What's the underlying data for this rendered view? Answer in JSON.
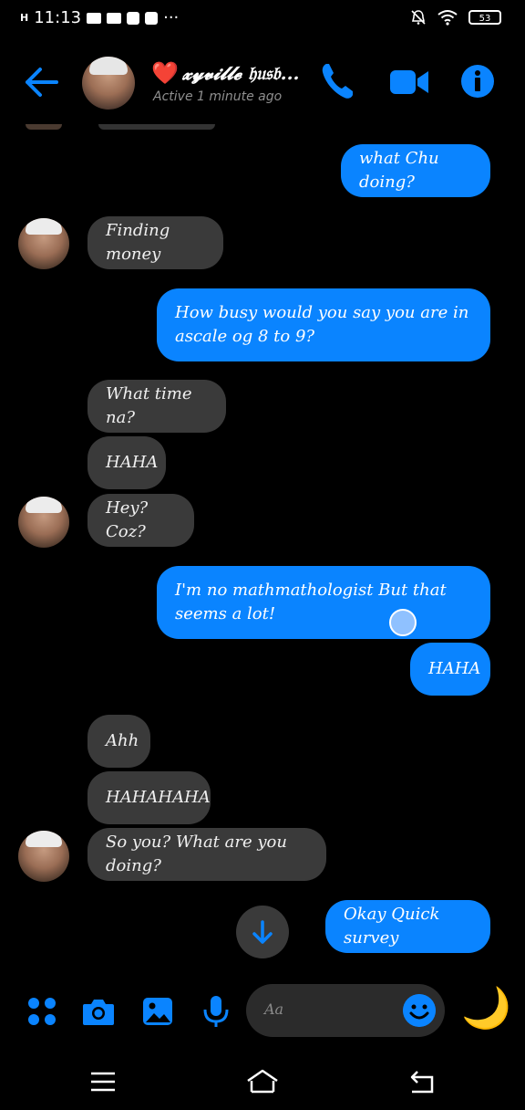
{
  "status_bar": {
    "carrier": "H",
    "time": "11:13",
    "more": "···",
    "battery": "53"
  },
  "header": {
    "heart": "❤️",
    "name": "𝔁𝔂𝓿𝓲𝓵𝓵𝓮 𝔥𝔲𝔰𝔟...",
    "status": "Active 1 minute ago"
  },
  "messages": [
    {
      "side": "out",
      "text": "what Chu doing?"
    },
    {
      "side": "in",
      "text": "Finding money"
    },
    {
      "side": "out",
      "text": "How busy would you say you are in ascale og 8 to 9?"
    },
    {
      "side": "in",
      "text": "What time na?"
    },
    {
      "side": "in",
      "text": "HAHA"
    },
    {
      "side": "in",
      "text": "Hey? Coz?"
    },
    {
      "side": "out",
      "text": "I'm no mathmathologist But that seems a lot!"
    },
    {
      "side": "out",
      "text": "HAHA"
    },
    {
      "side": "in",
      "text": "Ahh"
    },
    {
      "side": "in",
      "text": "HAHAHAHA"
    },
    {
      "side": "in",
      "text": "So you? What are you doing?"
    },
    {
      "side": "out",
      "text": "Okay Quick survey"
    }
  ],
  "composer": {
    "placeholder": "Aa",
    "sticker": "🌙"
  },
  "colors": {
    "accent": "#0a84ff",
    "incoming_bubble": "#3a3a3a",
    "background": "#000000"
  },
  "icons": [
    "back-arrow-icon",
    "phone-icon",
    "video-camera-icon",
    "info-icon",
    "apps-icon",
    "camera-icon",
    "gallery-icon",
    "microphone-icon",
    "emoji-icon",
    "scroll-down-icon",
    "menu-icon",
    "home-icon",
    "return-icon"
  ]
}
